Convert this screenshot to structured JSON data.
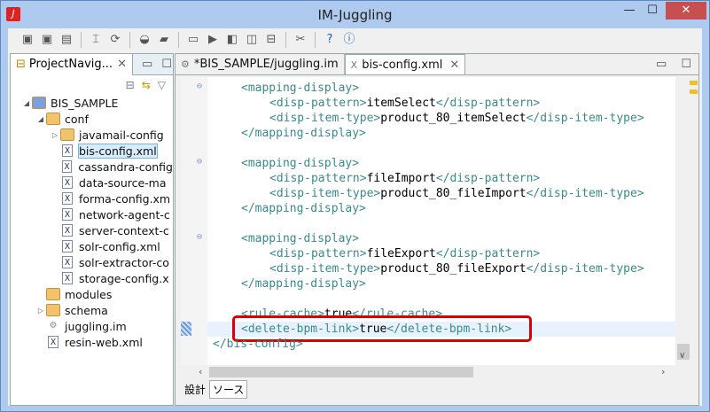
{
  "window": {
    "title": "IM-Juggling",
    "minimize": "—",
    "maximize": "☐",
    "close": "✕"
  },
  "toolbar": [
    "save",
    "save-as",
    "save-all",
    "build",
    "refresh",
    "dashboard",
    "open-folder",
    "monitor",
    "run",
    "debug",
    "window",
    "hierarchy",
    "tools",
    "help",
    "info"
  ],
  "navigator": {
    "tab_label": "ProjectNavig...",
    "close": "✕",
    "tree": [
      {
        "label": "BIS_SAMPLE",
        "depth": 0,
        "type": "project",
        "twisty": "◢"
      },
      {
        "label": "conf",
        "depth": 1,
        "type": "folder",
        "twisty": "◢"
      },
      {
        "label": "javamail-config",
        "depth": 2,
        "type": "folder",
        "twisty": "▷"
      },
      {
        "label": "bis-config.xml",
        "depth": 2,
        "type": "xml",
        "selected": true
      },
      {
        "label": "cassandra-config",
        "depth": 2,
        "type": "xml"
      },
      {
        "label": "data-source-ma",
        "depth": 2,
        "type": "xml"
      },
      {
        "label": "forma-config.xm",
        "depth": 2,
        "type": "xml"
      },
      {
        "label": "network-agent-c",
        "depth": 2,
        "type": "xml"
      },
      {
        "label": "server-context-c",
        "depth": 2,
        "type": "xml"
      },
      {
        "label": "solr-config.xml",
        "depth": 2,
        "type": "xml"
      },
      {
        "label": "solr-extractor-co",
        "depth": 2,
        "type": "xml"
      },
      {
        "label": "storage-config.x",
        "depth": 2,
        "type": "xml"
      },
      {
        "label": "modules",
        "depth": 1,
        "type": "folder"
      },
      {
        "label": "schema",
        "depth": 1,
        "type": "folder",
        "twisty": "▷"
      },
      {
        "label": "juggling.im",
        "depth": 1,
        "type": "im"
      },
      {
        "label": "resin-web.xml",
        "depth": 1,
        "type": "xml"
      }
    ]
  },
  "editor": {
    "tabs": [
      {
        "label": "*BIS_SAMPLE/juggling.im"
      },
      {
        "label": "bis-config.xml",
        "active": true,
        "close": "✕"
      }
    ],
    "lines": [
      {
        "indent": 1,
        "parts": [
          "<mapping-display>"
        ],
        "fold": true
      },
      {
        "indent": 2,
        "parts": [
          "<disp-pattern>",
          "itemSelect",
          "</disp-pattern>"
        ]
      },
      {
        "indent": 2,
        "parts": [
          "<disp-item-type>",
          "product_80_itemSelect",
          "</disp-item-type>"
        ]
      },
      {
        "indent": 1,
        "parts": [
          "</mapping-display>"
        ]
      },
      {
        "indent": 0,
        "parts": [
          ""
        ]
      },
      {
        "indent": 1,
        "parts": [
          "<mapping-display>"
        ],
        "fold": true
      },
      {
        "indent": 2,
        "parts": [
          "<disp-pattern>",
          "fileImport",
          "</disp-pattern>"
        ]
      },
      {
        "indent": 2,
        "parts": [
          "<disp-item-type>",
          "product_80_fileImport",
          "</disp-item-type>"
        ]
      },
      {
        "indent": 1,
        "parts": [
          "</mapping-display>"
        ]
      },
      {
        "indent": 0,
        "parts": [
          ""
        ]
      },
      {
        "indent": 1,
        "parts": [
          "<mapping-display>"
        ],
        "fold": true
      },
      {
        "indent": 2,
        "parts": [
          "<disp-pattern>",
          "fileExport",
          "</disp-pattern>"
        ]
      },
      {
        "indent": 2,
        "parts": [
          "<disp-item-type>",
          "product_80_fileExport",
          "</disp-item-type>"
        ]
      },
      {
        "indent": 1,
        "parts": [
          "</mapping-display>"
        ]
      },
      {
        "indent": 0,
        "parts": [
          ""
        ]
      },
      {
        "indent": 1,
        "parts": [
          "<rule-cache>",
          "true",
          "</rule-cache>"
        ]
      },
      {
        "indent": 1,
        "parts": [
          "<delete-bpm-link>",
          "true",
          "</delete-bpm-link>"
        ],
        "highlight": true
      },
      {
        "indent": 0,
        "parts": [
          "</bis-config>"
        ]
      }
    ],
    "bottom_tabs": [
      {
        "label": "設計"
      },
      {
        "label": "ソース",
        "active": true
      }
    ]
  },
  "colors": {
    "tag": "#3a8a8a",
    "highlight_box": "#dd0000",
    "title_bar": "#aecbef"
  }
}
